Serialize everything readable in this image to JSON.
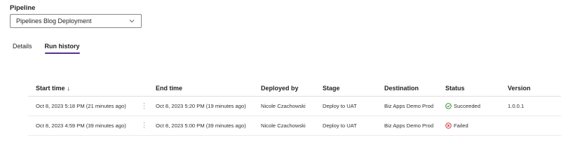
{
  "pipeline": {
    "label": "Pipeline",
    "selected": "Pipelines Blog Deployment"
  },
  "tabs": [
    {
      "label": "Details",
      "active": false
    },
    {
      "label": "Run history",
      "active": true
    }
  ],
  "table": {
    "headers": {
      "start_time": "Start time",
      "sort_indicator": "↓",
      "end_time": "End time",
      "deployed_by": "Deployed by",
      "stage": "Stage",
      "destination": "Destination",
      "status": "Status",
      "version": "Version"
    },
    "rows": [
      {
        "start_time": "Oct 8, 2023 5:18 PM (21 minutes ago)",
        "end_time": "Oct 8, 2023 5:20 PM (19 minutes ago)",
        "deployed_by": "Nicole Czachowski",
        "stage": "Deploy to UAT",
        "destination": "Biz Apps Demo Prod",
        "status": "Succeeded",
        "version": "1.0.0.1"
      },
      {
        "start_time": "Oct 8, 2023 4:59 PM (39 minutes ago)",
        "end_time": "Oct 8, 2023 5:00 PM (39 minutes ago)",
        "deployed_by": "Nicole Czachowski",
        "stage": "Deploy to UAT",
        "destination": "Biz Apps Demo Prod",
        "status": "Failed",
        "version": ""
      }
    ]
  },
  "colors": {
    "accent": "#5c2e91",
    "success": "#107c10",
    "failed": "#c50f1f"
  },
  "icons": {
    "dropdown": "chevron-down-icon",
    "row_menu": "more-vertical-icon",
    "succeeded": "check-circle-icon",
    "failed": "error-circle-icon"
  }
}
